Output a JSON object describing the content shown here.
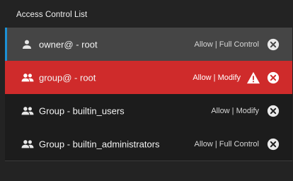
{
  "panel": {
    "title": "Access Control List"
  },
  "entries": [
    {
      "principal": "owner@ - root",
      "permission": "Allow | Full Control",
      "type_icon": "person-icon",
      "state": "selected"
    },
    {
      "principal": "group@ - root",
      "permission": "Allow | Modify",
      "type_icon": "group-icon",
      "state": "error",
      "status_icon": "warning-icon"
    },
    {
      "principal": "Group - builtin_users",
      "permission": "Allow | Modify",
      "type_icon": "group-icon",
      "state": "normal"
    },
    {
      "principal": "Group - builtin_administrators",
      "permission": "Allow | Full Control",
      "type_icon": "group-icon",
      "state": "normal"
    }
  ],
  "colors": {
    "accent": "#1c91d6",
    "error": "#cf2b2b",
    "selected": "#454545"
  }
}
